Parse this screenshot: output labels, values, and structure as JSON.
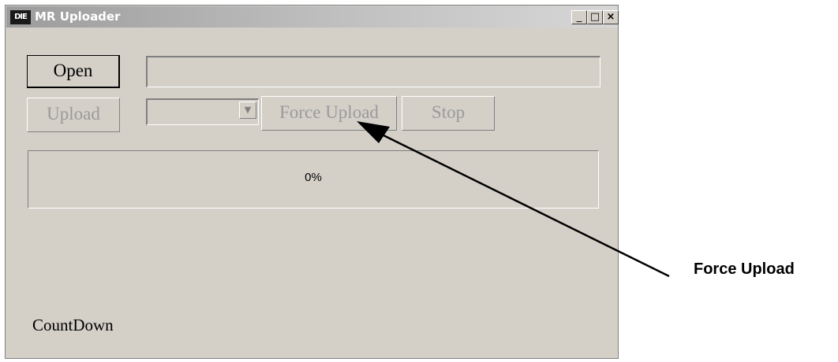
{
  "window": {
    "title": "MR Uploader",
    "app_icon_text": "DIE",
    "controls": {
      "minimize": "_",
      "maximize": "□",
      "close": "×"
    }
  },
  "buttons": {
    "open": "Open",
    "upload": "Upload",
    "force_upload": "Force Upload",
    "stop": "Stop"
  },
  "file_path_field": {
    "value": ""
  },
  "combo": {
    "selected": "",
    "arrow": "▼"
  },
  "progress": {
    "percent": 0,
    "label": "0%"
  },
  "countdown": {
    "label": "CountDown"
  },
  "annotation": {
    "label": "Force Upload"
  }
}
